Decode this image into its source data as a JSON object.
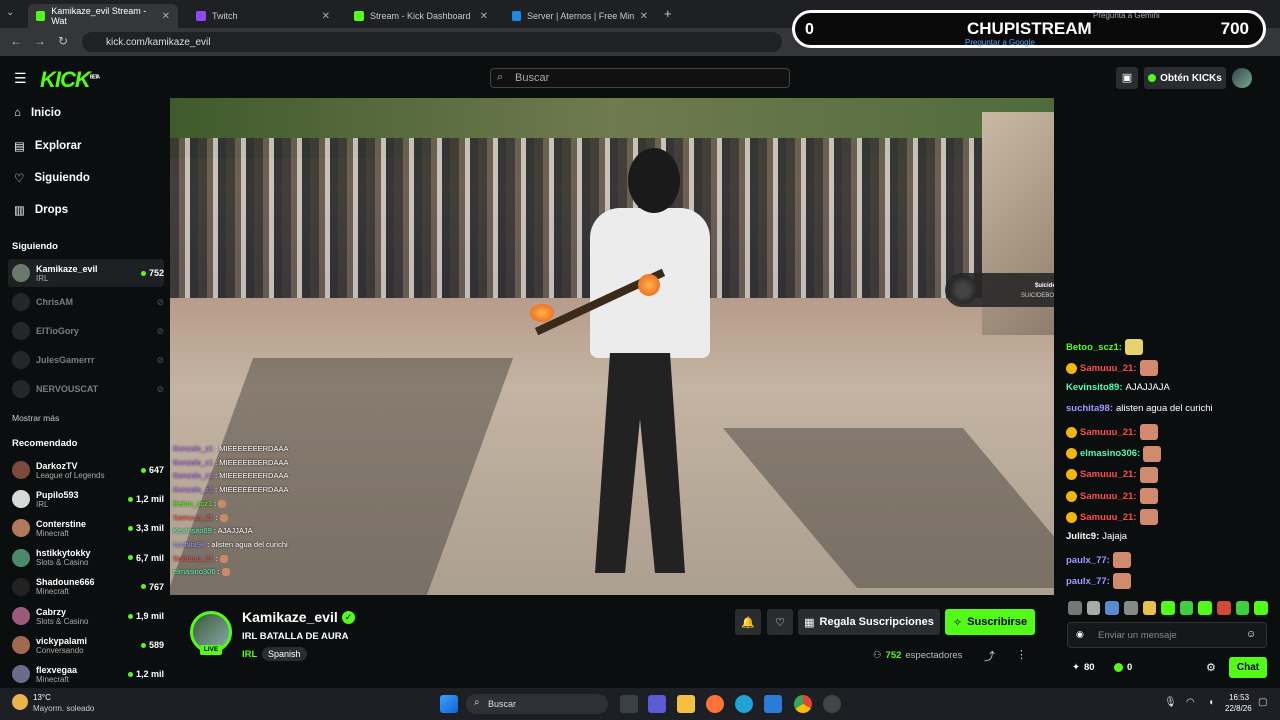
{
  "browser": {
    "tabs": [
      {
        "label": "Kamikaze_evil Stream - Wat",
        "color": "#53fc18"
      },
      {
        "label": "Twitch",
        "color": "#9146ff"
      },
      {
        "label": "Stream - Kick Dashboard",
        "color": "#53fc18"
      },
      {
        "label": "Server | Aternos | Free Minecraf",
        "color": "#1e88e5"
      }
    ],
    "url": "kick.com/kamikaze_evil"
  },
  "overlay": {
    "left": "0",
    "title": "CHUPISTREAM",
    "right": "700",
    "gemini": "Pregunta a Gemini",
    "google": "Preguntar a Google"
  },
  "header": {
    "logo": "KICK",
    "beta": "BETA",
    "search_placeholder": "Buscar",
    "get_kicks": "Obtén KICKs"
  },
  "sidebar": {
    "nav": [
      "Inicio",
      "Explorar",
      "Siguiendo",
      "Drops"
    ],
    "following_title": "Siguiendo",
    "following": [
      {
        "name": "Kamikaze_evil",
        "sub": "IRL",
        "viewers": "752",
        "live": true
      },
      {
        "name": "ChrisAM",
        "sub": "",
        "viewers": "",
        "live": false
      },
      {
        "name": "ElTioGory",
        "sub": "",
        "viewers": "",
        "live": false
      },
      {
        "name": "JulesGamerrr",
        "sub": "",
        "viewers": "",
        "live": false
      },
      {
        "name": "NERVOUSCAT",
        "sub": "",
        "viewers": "",
        "live": false
      }
    ],
    "show_more": "Mostrar más",
    "recommended_title": "Recomendado",
    "recommended": [
      {
        "name": "DarkozTV",
        "sub": "League of Legends",
        "viewers": "647"
      },
      {
        "name": "Pupilo593",
        "sub": "IRL",
        "viewers": "1,2 mil"
      },
      {
        "name": "Conterstine",
        "sub": "Minecraft",
        "viewers": "3,3 mil"
      },
      {
        "name": "hstikkytokky",
        "sub": "Slots & Casino",
        "viewers": "6,7 mil"
      },
      {
        "name": "Shadoune666",
        "sub": "Minecraft",
        "viewers": "767"
      },
      {
        "name": "Cabrzy",
        "sub": "Slots & Casino",
        "viewers": "1,9 mil"
      },
      {
        "name": "vickypalami",
        "sub": "Conversando",
        "viewers": "589"
      },
      {
        "name": "flexvegaa",
        "sub": "Minecraft",
        "viewers": "1,2 mil"
      }
    ]
  },
  "video_chat": [
    {
      "user": "Gonzalo_z1",
      "text": "MIEEEEEEERDAAA",
      "color": "#b66cff"
    },
    {
      "user": "Gonzalo_z1",
      "text": "MIEEEEEEERDAAA",
      "color": "#b66cff"
    },
    {
      "user": "Gonzalo_z1",
      "text": "MIEEEEEEERDAAA",
      "color": "#b66cff"
    },
    {
      "user": "Gonzalo_z1",
      "text": "MIEEEEEEERDAAA",
      "color": "#b66cff"
    },
    {
      "user": "Betoo_scz1",
      "text": "",
      "color": "#53fc18"
    },
    {
      "user": "Samuuu_21",
      "text": "",
      "color": "#ff4c4c"
    },
    {
      "user": "Kevinsito89",
      "text": "AJAJJAJA",
      "color": "#53fcb0"
    },
    {
      "user": "suchita98",
      "text": "alisten agua del curichi",
      "color": "#9a9aff"
    },
    {
      "user": "Samuuu_21",
      "text": "",
      "color": "#ff4c4c"
    },
    {
      "user": "elmasino306",
      "text": "",
      "color": "#53fcb0"
    }
  ],
  "cam": {
    "card_title": "$uicideboy$",
    "card_sub": "SUICIDEBOY$ - O PANA!"
  },
  "stream": {
    "streamer": "Kamikaze_evil",
    "title": "IRL BATALLA DE AURA",
    "category": "IRL",
    "language": "Spanish",
    "live": "LIVE",
    "viewers": "752",
    "viewers_label": "espectadores",
    "gift_label": "Regala Suscripciones",
    "subscribe_label": "Suscribirse"
  },
  "chat": {
    "messages": [
      {
        "user": "Betoo_scz1:",
        "text": "",
        "color": "#53fc18",
        "badge": false,
        "emote": true
      },
      {
        "user": "Samuuu_21:",
        "text": "",
        "color": "#ff4c4c",
        "badge": true,
        "emote": true
      },
      {
        "user": "Kevinsito89:",
        "text": "AJAJJAJA",
        "color": "#53fcb0",
        "badge": false,
        "emote": false
      },
      {
        "user": "suchita98:",
        "text": "alisten agua del curichi",
        "color": "#9a9aff",
        "badge": false,
        "emote": false
      },
      {
        "user": "Samuuu_21:",
        "text": "",
        "color": "#ff4c4c",
        "badge": true,
        "emote": true
      },
      {
        "user": "elmasino306:",
        "text": "",
        "color": "#53fcb0",
        "badge": true,
        "emote": true
      },
      {
        "user": "Samuuu_21:",
        "text": "",
        "color": "#ff4c4c",
        "badge": true,
        "emote": true
      },
      {
        "user": "Samuuu_21:",
        "text": "",
        "color": "#ff4c4c",
        "badge": true,
        "emote": true
      },
      {
        "user": "Samuuu_21:",
        "text": "",
        "color": "#ff4c4c",
        "badge": true,
        "emote": true
      },
      {
        "user": "Julitc9:",
        "text": "Jajaja",
        "color": "#ffffff",
        "badge": false,
        "emote": false
      },
      {
        "user": "paulx_77:",
        "text": "",
        "color": "#9a9aff",
        "badge": false,
        "emote": true
      },
      {
        "user": "paulx_77:",
        "text": "",
        "color": "#9a9aff",
        "badge": false,
        "emote": true
      }
    ],
    "input_placeholder": "Enviar un mensaje",
    "points": "80",
    "kicks": "0",
    "send_label": "Chat"
  },
  "taskbar": {
    "weather_temp": "13°C",
    "weather_desc": "Mayorm. soleado",
    "search": "Buscar",
    "time": "16:53",
    "date": "22/8/26"
  }
}
